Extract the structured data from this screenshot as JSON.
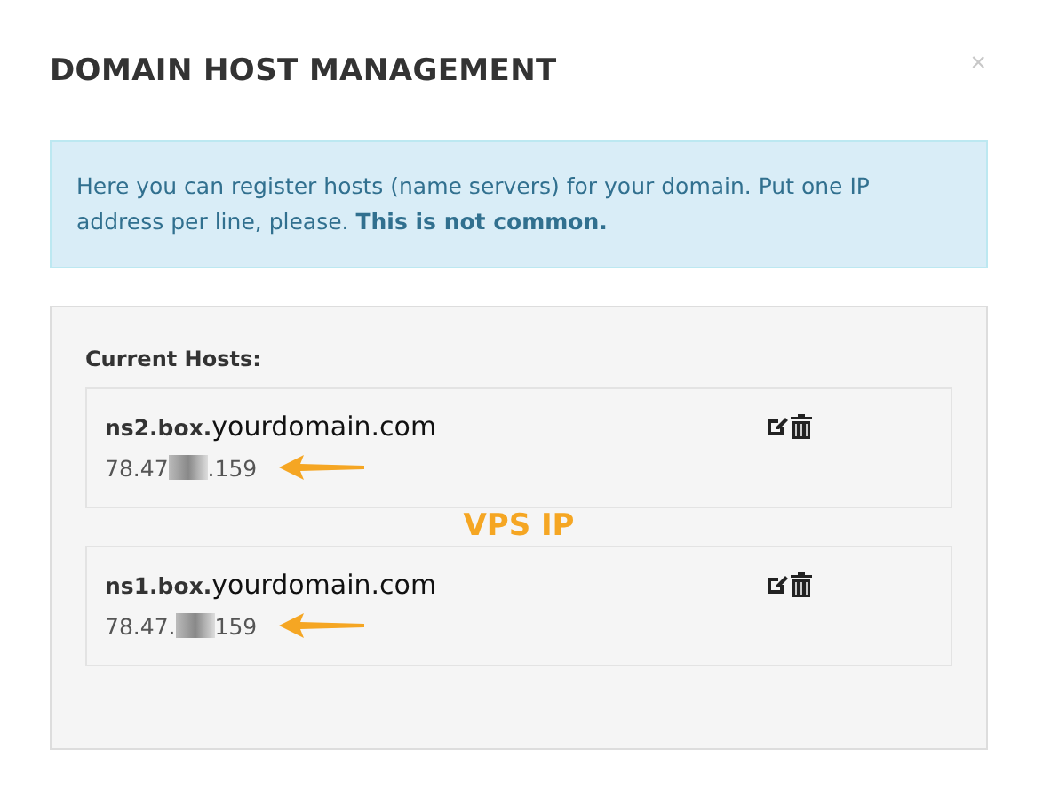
{
  "modal": {
    "title": "DOMAIN HOST MANAGEMENT",
    "close": "×"
  },
  "alert": {
    "text": "Here you can register hosts (name servers) for your domain. Put one IP address per line, please. **This is not common.**"
  },
  "panel": {
    "heading": "Current Hosts:",
    "hosts": [
      {
        "prefix": "ns2.box.",
        "domain": "yourdomain.com",
        "ip_start": "78.47",
        "ip_end": ".159",
        "redacted": true,
        "arrow": true
      },
      {
        "prefix": "ns1.box.",
        "domain": "yourdomain.com",
        "ip_start": "78.47.",
        "ip_end": "159",
        "redacted": true,
        "arrow": true
      }
    ],
    "annotation": "VPS IP"
  }
}
